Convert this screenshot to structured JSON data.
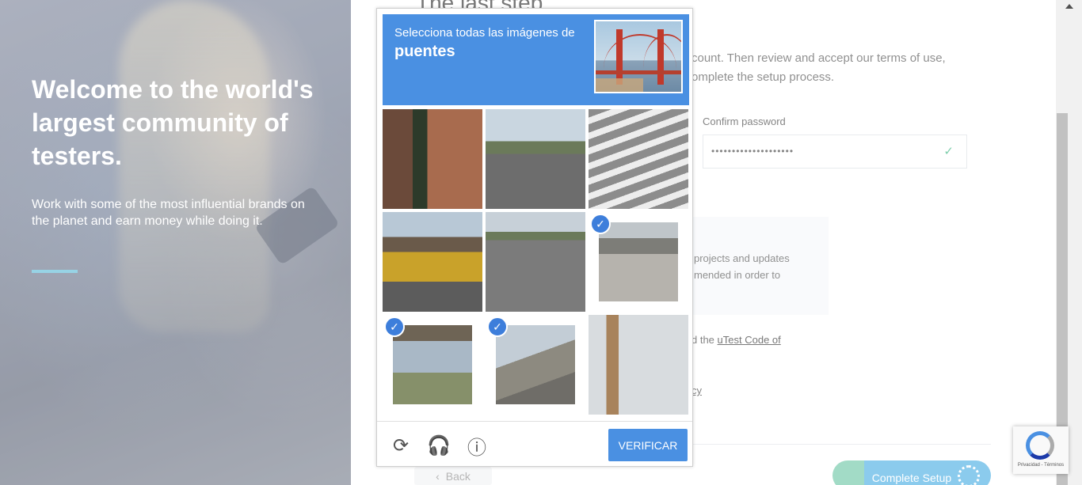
{
  "hero": {
    "title": "Welcome to the world's largest community of testers.",
    "subtitle": "Work with some of the most influential brands on the planet and earn money while doing it."
  },
  "form": {
    "heading": "The last step",
    "intro": "count. Then review and accept our terms of use, omplete the setup process.",
    "confirm_password_label": "Confirm password",
    "confirm_password_value": "••••••••••••••••••••",
    "info_text": "projects and updates mended in order to",
    "code_prefix": "d the ",
    "code_link": "uTest Code of",
    "privacy_text": "cy",
    "back_label": "Back",
    "complete_label": "Complete Setup"
  },
  "captcha": {
    "prompt": "Selecciona todas las imágenes de",
    "target": "puentes",
    "verify_label": "VERIFICAR",
    "tiles": [
      {
        "selected": false
      },
      {
        "selected": false
      },
      {
        "selected": false
      },
      {
        "selected": false
      },
      {
        "selected": false
      },
      {
        "selected": true
      },
      {
        "selected": true
      },
      {
        "selected": true
      },
      {
        "selected": false
      }
    ],
    "colors": {
      "accent": "#4a90e2",
      "check": "#3d7edb"
    }
  },
  "badge": {
    "text": "Privacidad - Términos"
  }
}
